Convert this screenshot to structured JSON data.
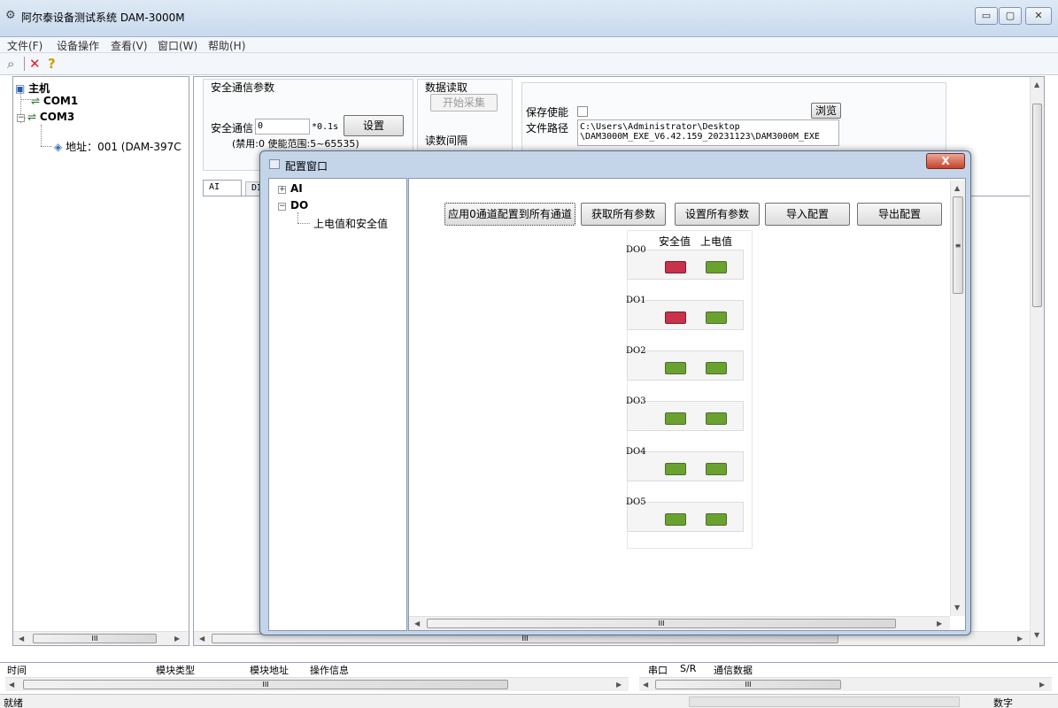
{
  "window": {
    "title": "阿尔泰设备测试系统 DAM-3000M",
    "minimize": "▭",
    "maximize": "▢",
    "close": "✕"
  },
  "menu": [
    "文件(F)",
    "设备操作",
    "查看(V)",
    "窗口(W)",
    "帮助(H)"
  ],
  "toolbar": {
    "icons": [
      "search-icon",
      "delete-icon",
      "help-icon"
    ]
  },
  "tree": {
    "host": "主机",
    "com1": "COM1",
    "com3": "COM3",
    "address": "地址：001 (DAM-397C"
  },
  "safety": {
    "group_title": "安全通信参数",
    "label": "安全通信",
    "value": "0",
    "unit": "*0.1s",
    "set_button": "设置",
    "hint": "(禁用:0 使能范围:5~65535)"
  },
  "data_read": {
    "group_title": "数据读取",
    "start_button": "开始采集",
    "interval_label": "读数间隔"
  },
  "save": {
    "enable_label": "保存使能",
    "enabled": false,
    "browse_button": "浏览",
    "path_label": "文件路径",
    "path_line1": "C:\\Users\\Administrator\\Desktop",
    "path_line2": "\\DAM3000M_EXE_V6.42.159_20231123\\DAM3000M_EXE"
  },
  "tabs": [
    "AI",
    "DI"
  ],
  "dialog": {
    "title": "配置窗口",
    "close": "X",
    "tree": {
      "ai": "AI",
      "do": "DO",
      "do_child": "上电值和安全值"
    },
    "buttons": {
      "apply_all": "应用0通道配置到所有通道",
      "get_all": "获取所有参数",
      "set_all": "设置所有参数",
      "import": "导入配置",
      "export": "导出配置"
    },
    "col_safe": "安全值",
    "col_power": "上电值",
    "channels": [
      {
        "name": "DO0",
        "safe": "red",
        "power": "green"
      },
      {
        "name": "DO1",
        "safe": "red",
        "power": "green"
      },
      {
        "name": "DO2",
        "safe": "green",
        "power": "green"
      },
      {
        "name": "DO3",
        "safe": "green",
        "power": "green"
      },
      {
        "name": "DO4",
        "safe": "green",
        "power": "green"
      },
      {
        "name": "DO5",
        "safe": "green",
        "power": "green"
      }
    ],
    "scroll_mark": "III"
  },
  "colors": {
    "led_red": "#c9324a",
    "led_green": "#6aa230",
    "titlebar": "#c9daee"
  },
  "scroll_mark": "III",
  "log": {
    "cols": [
      "时间",
      "模块类型",
      "模块地址",
      "操作信息"
    ]
  },
  "comm": {
    "cols": [
      "串口",
      "S/R",
      "通信数据"
    ]
  },
  "status": {
    "ready": "就绪",
    "mode": "数字"
  }
}
